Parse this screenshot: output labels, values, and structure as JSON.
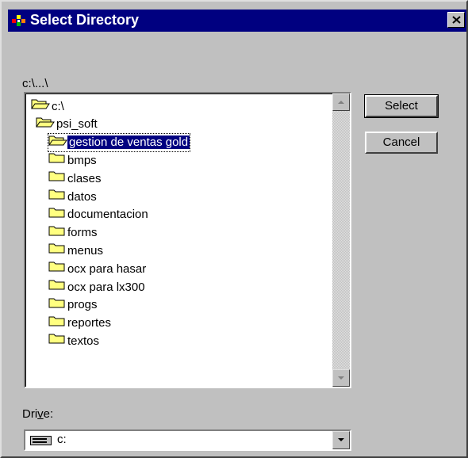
{
  "window": {
    "title": "Select Directory",
    "close_symbol": "✕"
  },
  "current_path": "c:\\...\\",
  "directories": [
    {
      "label": "c:\\",
      "depth": 0,
      "icon": "folder-open-icon",
      "selected": false
    },
    {
      "label": "psi_soft",
      "depth": 1,
      "icon": "folder-open-icon",
      "selected": false
    },
    {
      "label": "gestion de ventas gold",
      "depth": 2,
      "icon": "folder-open-icon",
      "selected": true
    },
    {
      "label": "bmps",
      "depth": 3,
      "icon": "folder-closed-icon",
      "selected": false
    },
    {
      "label": "clases",
      "depth": 3,
      "icon": "folder-closed-icon",
      "selected": false
    },
    {
      "label": "datos",
      "depth": 3,
      "icon": "folder-closed-icon",
      "selected": false
    },
    {
      "label": "documentacion",
      "depth": 3,
      "icon": "folder-closed-icon",
      "selected": false
    },
    {
      "label": "forms",
      "depth": 3,
      "icon": "folder-closed-icon",
      "selected": false
    },
    {
      "label": "menus",
      "depth": 3,
      "icon": "folder-closed-icon",
      "selected": false
    },
    {
      "label": "ocx para hasar",
      "depth": 3,
      "icon": "folder-closed-icon",
      "selected": false
    },
    {
      "label": "ocx para lx300",
      "depth": 3,
      "icon": "folder-closed-icon",
      "selected": false
    },
    {
      "label": "progs",
      "depth": 3,
      "icon": "folder-closed-icon",
      "selected": false
    },
    {
      "label": "reportes",
      "depth": 3,
      "icon": "folder-closed-icon",
      "selected": false
    },
    {
      "label": "textos",
      "depth": 3,
      "icon": "folder-closed-icon",
      "selected": false
    }
  ],
  "buttons": {
    "select": "Select",
    "cancel": "Cancel"
  },
  "drive": {
    "label_prefix": "Dri",
    "label_accel": "v",
    "label_suffix": "e:",
    "value": "c:",
    "icon": "drive-icon"
  },
  "colors": {
    "title_bar": "#000080",
    "selection": "#000080",
    "dialog_face": "#c0c0c0",
    "folder": "#ffff80"
  }
}
